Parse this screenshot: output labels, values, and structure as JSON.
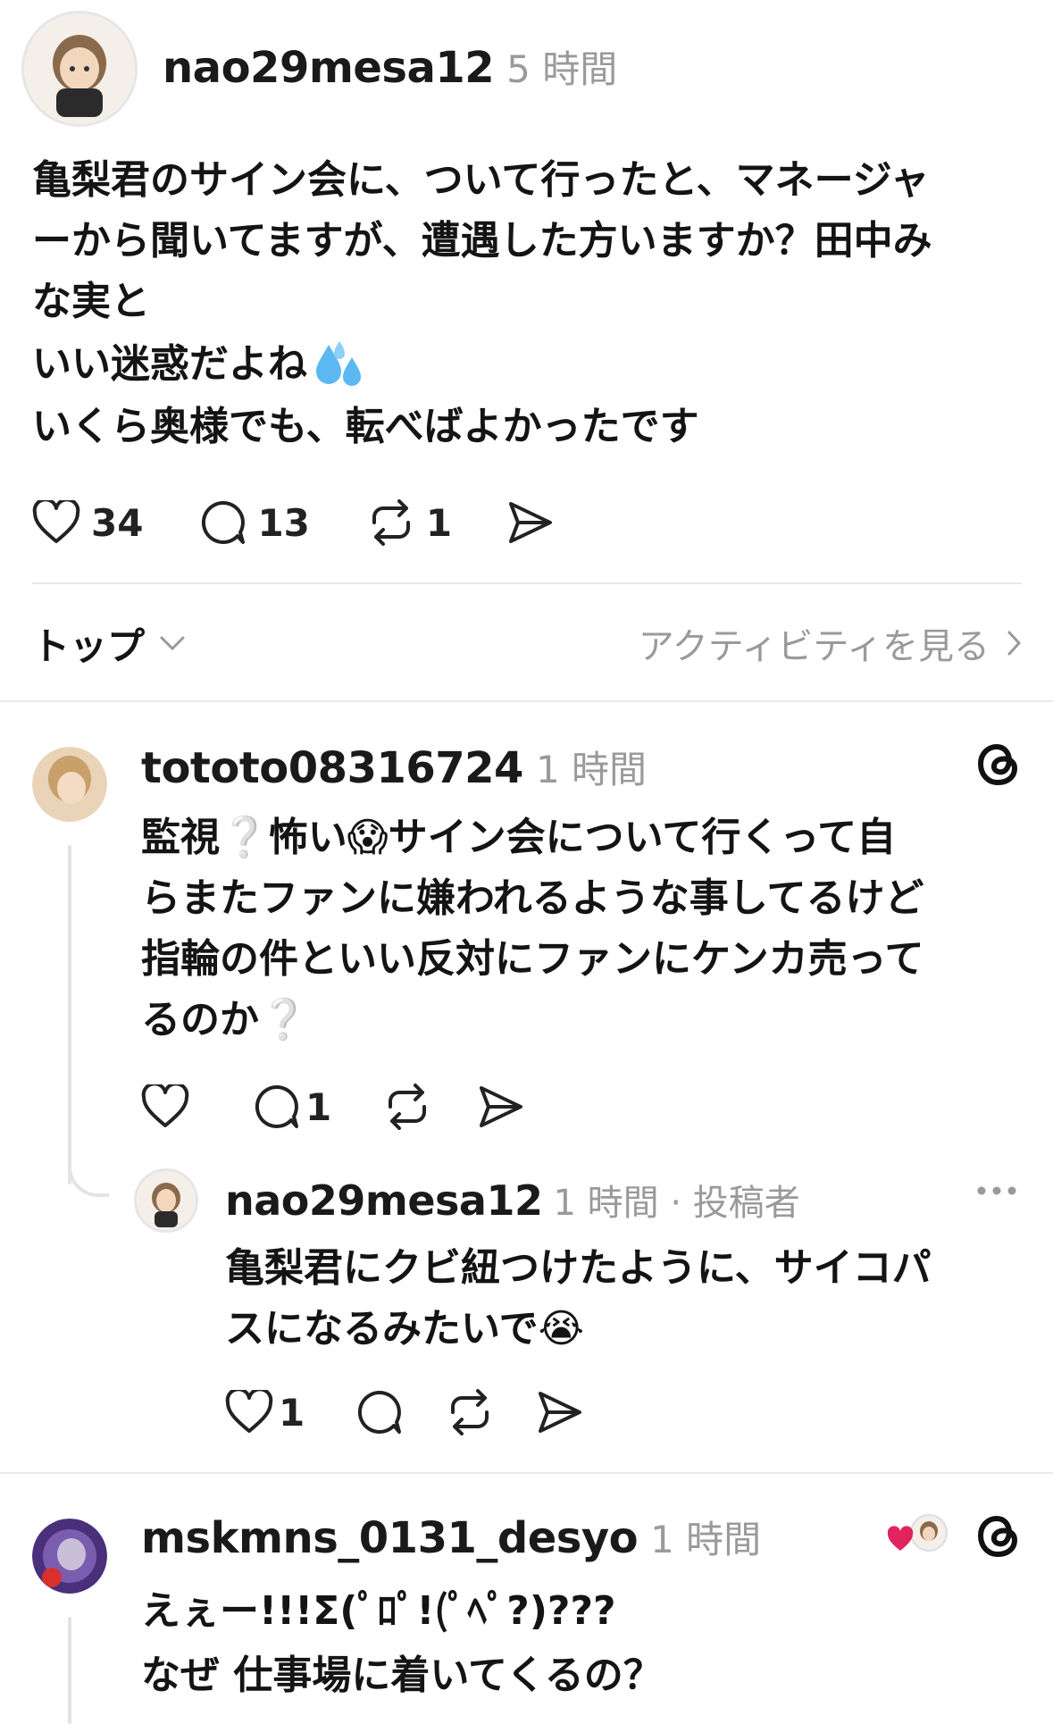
{
  "post": {
    "username": "nao29mesa12",
    "time": "5 時間",
    "lines": [
      "亀梨君のサイン会に、ついて行ったと、マネージャ",
      "ーから聞いてますが、遭遇した方いますか？田中み",
      "な実と",
      "いい迷惑だよね",
      "いくら奥様でも、転べばよかったです"
    ],
    "likes": "34",
    "replies": "13",
    "reposts": "1"
  },
  "sort": {
    "label": "トップ",
    "activity_link": "アクティビティを見る"
  },
  "comments": [
    {
      "username": "tototo08316724",
      "time": "1 時間",
      "lines": [
        "監視❔怖い😱サイン会について行くって自",
        "らまたファンに嫌われるような事してるけど",
        "指輪の件といい反対にファンにケンカ売って",
        "るのか❔"
      ],
      "replies": "1",
      "reply": {
        "username": "nao29mesa12",
        "meta": "1 時間 · 投稿者",
        "lines": [
          "亀梨君にクビ紐つけたように、サイコパ",
          "スになるみたいで😭"
        ],
        "likes": "1"
      }
    },
    {
      "username": "mskmns_0131_desyo",
      "time": "1 時間",
      "lines": [
        "えぇー!!!Σ(ﾟﾛﾟ!(ﾟﾍﾟ?)???",
        "なぜ 仕事場に着いてくるの？"
      ]
    }
  ],
  "icons": {
    "like": "heart-icon",
    "reply": "comment-bubble-icon",
    "repost": "repost-icon",
    "share": "send-icon",
    "threads": "threads-logo-icon",
    "more": "more-dots-icon"
  },
  "colors": {
    "text": "#141414",
    "meta": "#9a9a9a",
    "divider": "#e8e8e8",
    "heart_badge": "#e0245e"
  }
}
